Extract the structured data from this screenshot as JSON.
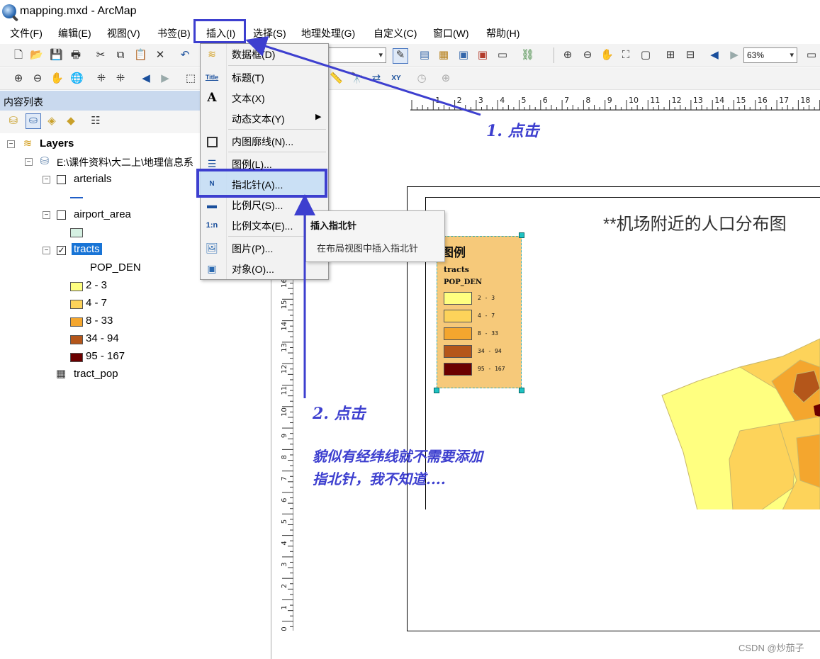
{
  "window": {
    "title": "mapping.mxd - ArcMap"
  },
  "menubar": {
    "items": [
      "文件(F)",
      "编辑(E)",
      "视图(V)",
      "书签(B)",
      "插入(I)",
      "选择(S)",
      "地理处理(G)",
      "自定义(C)",
      "窗口(W)",
      "帮助(H)"
    ]
  },
  "toolbar": {
    "zoom": "63%"
  },
  "toc": {
    "title": "内容列表",
    "root": "Layers",
    "db_path": "E:\\课件资料\\大二上\\地理信息系",
    "layers": [
      {
        "name": "arterials",
        "checked": false
      },
      {
        "name": "airport_area",
        "checked": false
      },
      {
        "name": "tracts",
        "checked": true
      }
    ],
    "field": "POP_DEN",
    "classes": [
      {
        "label": "2 - 3",
        "color": "#ffff80"
      },
      {
        "label": "4 - 7",
        "color": "#fdd35a"
      },
      {
        "label": "8 - 33",
        "color": "#f4a62e"
      },
      {
        "label": "34 - 94",
        "color": "#b4561a"
      },
      {
        "label": "95 - 167",
        "color": "#6b0000"
      }
    ],
    "table": "tract_pop"
  },
  "dropdown": {
    "items": [
      {
        "label": "数据框(D)",
        "icon": "layers-icon"
      },
      {
        "label": "标题(T)",
        "icon": "title-icon",
        "icon_text": "Title"
      },
      {
        "label": "文本(X)",
        "icon": "text-icon",
        "icon_text": "A"
      },
      {
        "label": "动态文本(Y)",
        "icon": "none",
        "submenu": true
      },
      {
        "label": "内图廓线(N)...",
        "icon": "neatline-icon"
      },
      {
        "label": "图例(L)...",
        "icon": "legend-icon"
      },
      {
        "label": "指北针(A)...",
        "icon": "north-arrow-icon",
        "icon_text": "N",
        "highlighted": true
      },
      {
        "label": "比例尺(S)...",
        "icon": "scale-bar-icon"
      },
      {
        "label": "比例文本(E)...",
        "icon": "scale-text-icon",
        "icon_text": "1:n"
      },
      {
        "label": "图片(P)...",
        "icon": "picture-icon"
      },
      {
        "label": "对象(O)...",
        "icon": "object-icon"
      }
    ]
  },
  "tooltip": {
    "title": "插入指北针",
    "body": "在布局视图中插入指北针"
  },
  "map": {
    "title": "**机场附近的人口分布图",
    "legend_title": "图例",
    "legend_layer": "tracts",
    "legend_field": "POP_DEN",
    "legend_classes": [
      "2 - 3",
      "4 - 7",
      "8 - 33",
      "34 - 94",
      "95 - 167"
    ]
  },
  "annotations": {
    "step1": "1. 点击",
    "step2": "2. 点击",
    "note_line1": "貌似有经纬线就不需要添加",
    "note_line2": "指北针，我不知道...."
  },
  "watermark": "CSDN @炒茄子"
}
